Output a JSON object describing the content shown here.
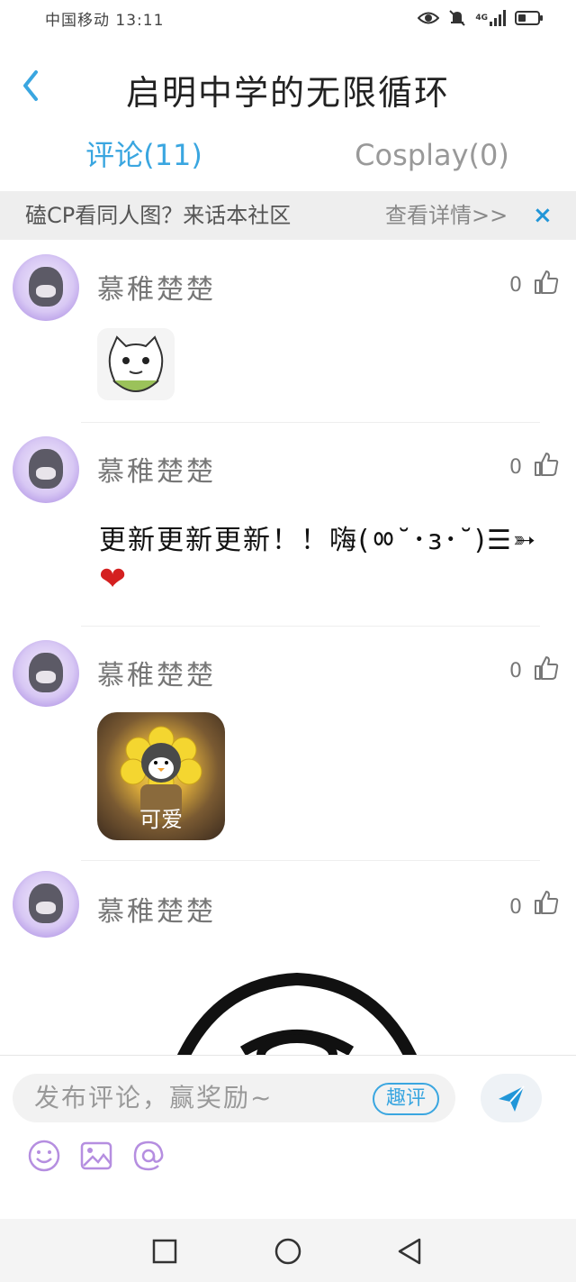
{
  "status_bar": {
    "carrier_time": "中国移动 13:11",
    "network": "4G",
    "icons": [
      "eye-icon",
      "mute-icon",
      "signal-icon",
      "battery-icon"
    ],
    "battery_level": 0.4
  },
  "header": {
    "back_icon": "chevron-left-icon",
    "title": "启明中学的无限循环"
  },
  "tabs": [
    {
      "label": "评论(11)",
      "active": true
    },
    {
      "label": "Cosplay(0)",
      "active": false
    }
  ],
  "banner": {
    "text": "磕CP看同人图？来话本社区",
    "link": "查看详情>>",
    "close": "×"
  },
  "comments": [
    {
      "username": "慕稚楚楚",
      "likes": "0",
      "type": "sticker",
      "sticker": "cat-sticker"
    },
    {
      "username": "慕稚楚楚",
      "likes": "0",
      "type": "text",
      "text": "更新更新更新！！嗨(ㆀ˘･з･˘)☰➳",
      "emoji": "❤"
    },
    {
      "username": "慕稚楚楚",
      "likes": "0",
      "type": "sticker",
      "sticker": "penguin-sticker",
      "caption": "可爱"
    },
    {
      "username": "慕稚楚楚",
      "likes": "0",
      "type": "sticker",
      "sticker": "large-sticker"
    }
  ],
  "input": {
    "placeholder": "发布评论，赢奖励~",
    "quping": "趣评",
    "tools": [
      "emoji-icon",
      "image-icon",
      "mention-icon"
    ]
  },
  "colors": {
    "accent": "#3aa6e0",
    "like": "#777777",
    "heart": "#d42020",
    "tool_purple": "#b58ee0"
  },
  "navbar": [
    "recent-apps-icon",
    "home-icon",
    "back-icon"
  ]
}
